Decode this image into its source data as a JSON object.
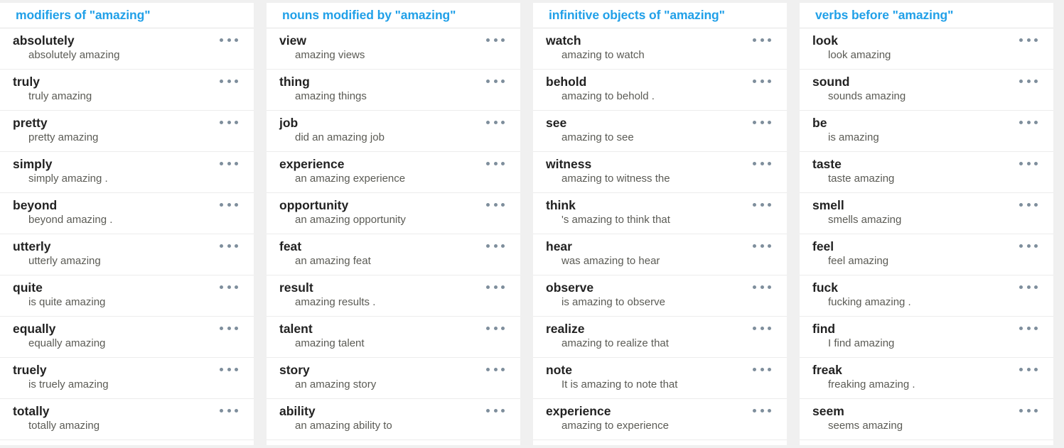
{
  "theme": {
    "header_color": "#21a0e8",
    "word_color": "#222222",
    "example_color": "#5b5b55",
    "menu_dot_color": "#7e8e9c",
    "page_background": "#f0f0f0",
    "column_background": "#ffffff",
    "row_divider_color": "#ececec"
  },
  "menu_icon": "ellipsis-horizontal-icon",
  "columns": [
    {
      "title": "modifiers of \"amazing\"",
      "rows": [
        {
          "word": "absolutely",
          "example": "absolutely amazing"
        },
        {
          "word": "truly",
          "example": "truly amazing"
        },
        {
          "word": "pretty",
          "example": "pretty amazing"
        },
        {
          "word": "simply",
          "example": "simply amazing ."
        },
        {
          "word": "beyond",
          "example": "beyond amazing ."
        },
        {
          "word": "utterly",
          "example": "utterly amazing"
        },
        {
          "word": "quite",
          "example": "is quite amazing"
        },
        {
          "word": "equally",
          "example": "equally amazing"
        },
        {
          "word": "truely",
          "example": "is truely amazing"
        },
        {
          "word": "totally",
          "example": "totally amazing"
        }
      ]
    },
    {
      "title": "nouns modified by \"amazing\"",
      "rows": [
        {
          "word": "view",
          "example": "amazing views"
        },
        {
          "word": "thing",
          "example": "amazing things"
        },
        {
          "word": "job",
          "example": "did an amazing job"
        },
        {
          "word": "experience",
          "example": "an amazing experience"
        },
        {
          "word": "opportunity",
          "example": "an amazing opportunity"
        },
        {
          "word": "feat",
          "example": "an amazing feat"
        },
        {
          "word": "result",
          "example": "amazing results ."
        },
        {
          "word": "talent",
          "example": "amazing talent"
        },
        {
          "word": "story",
          "example": "an amazing story"
        },
        {
          "word": "ability",
          "example": "an amazing ability to"
        }
      ]
    },
    {
      "title": "infinitive objects of \"amazing\"",
      "rows": [
        {
          "word": "watch",
          "example": "amazing to watch"
        },
        {
          "word": "behold",
          "example": "amazing to behold ."
        },
        {
          "word": "see",
          "example": "amazing to see"
        },
        {
          "word": "witness",
          "example": "amazing to witness the"
        },
        {
          "word": "think",
          "example": "'s amazing to think that"
        },
        {
          "word": "hear",
          "example": "was amazing to hear"
        },
        {
          "word": "observe",
          "example": "is amazing to observe"
        },
        {
          "word": "realize",
          "example": "amazing to realize that"
        },
        {
          "word": "note",
          "example": "It is amazing to note that"
        },
        {
          "word": "experience",
          "example": "amazing to experience"
        }
      ]
    },
    {
      "title": "verbs before \"amazing\"",
      "rows": [
        {
          "word": "look",
          "example": "look amazing"
        },
        {
          "word": "sound",
          "example": "sounds amazing"
        },
        {
          "word": "be",
          "example": "is amazing"
        },
        {
          "word": "taste",
          "example": "taste amazing"
        },
        {
          "word": "smell",
          "example": "smells amazing"
        },
        {
          "word": "feel",
          "example": "feel amazing"
        },
        {
          "word": "fuck",
          "example": "fucking amazing ."
        },
        {
          "word": "find",
          "example": "I find amazing"
        },
        {
          "word": "freak",
          "example": "freaking amazing ."
        },
        {
          "word": "seem",
          "example": "seems amazing"
        }
      ]
    }
  ]
}
